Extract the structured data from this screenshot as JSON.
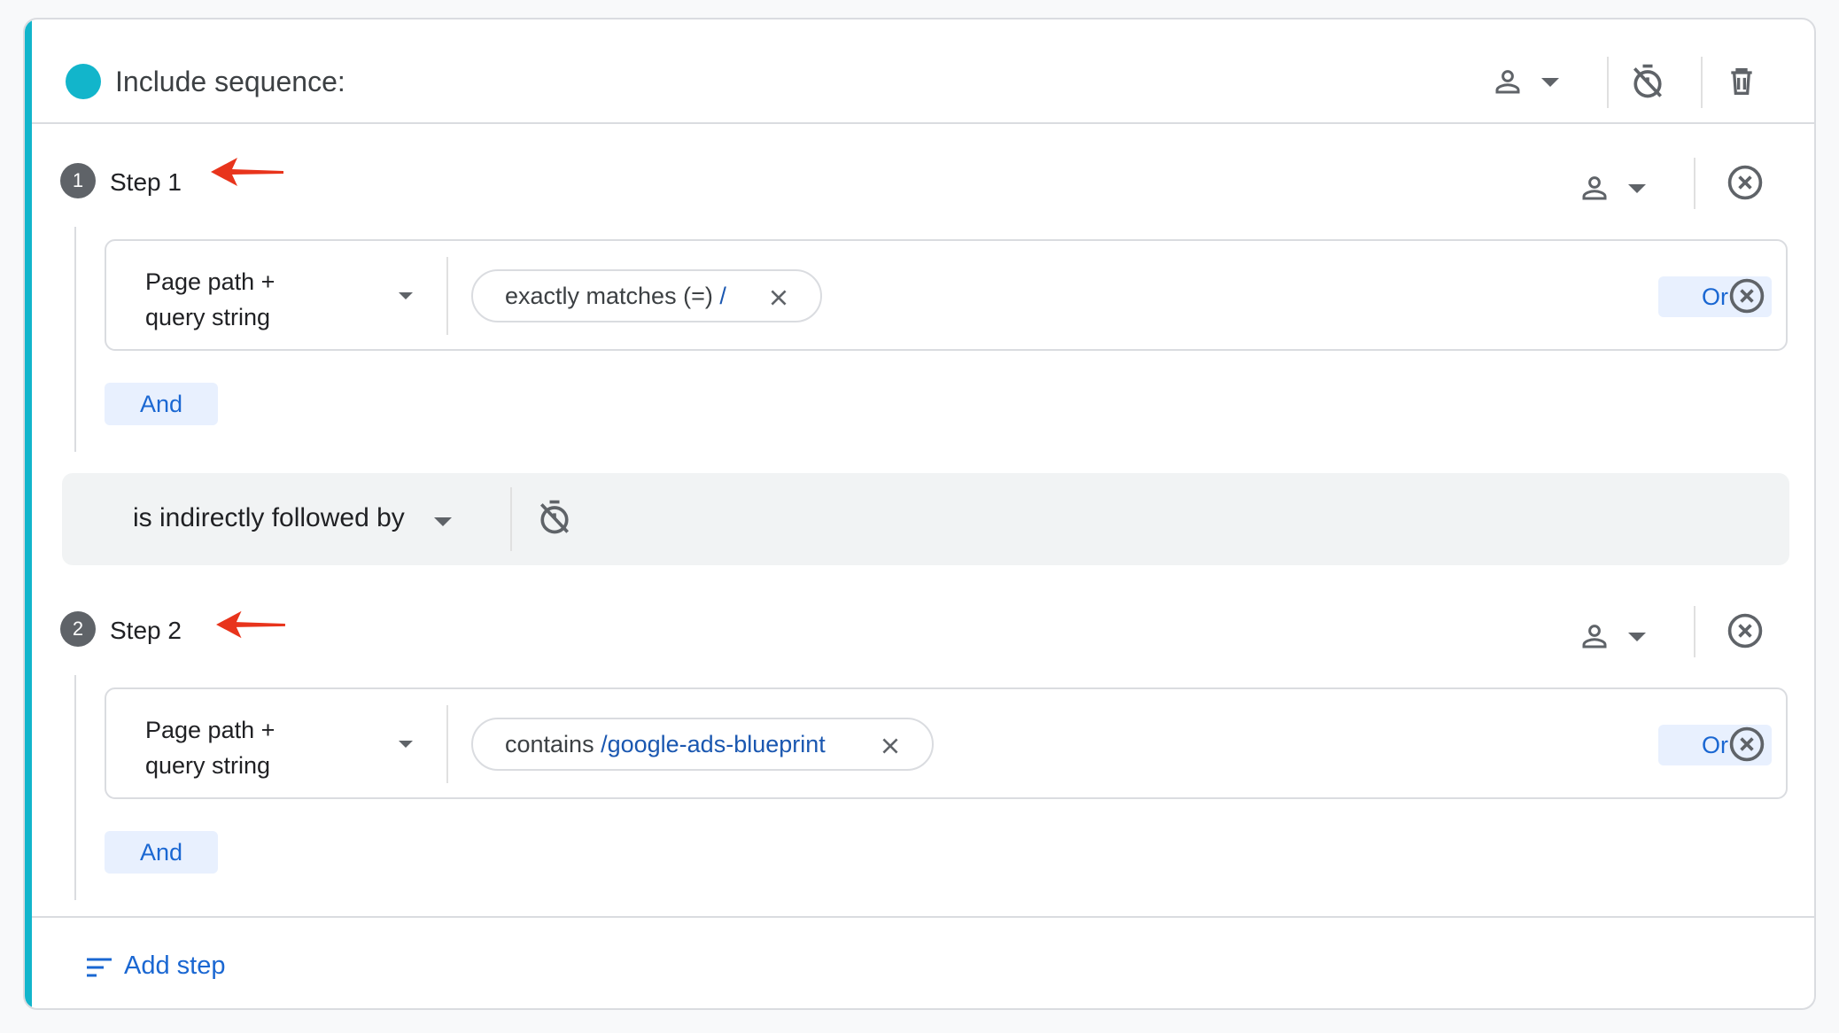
{
  "header": {
    "title": "Include sequence:"
  },
  "steps": [
    {
      "number": "1",
      "label": "Step 1",
      "dimension": "Page path + query string",
      "condition_operator": "exactly matches (=)",
      "condition_value": "/",
      "or_label": "Or",
      "and_label": "And"
    },
    {
      "number": "2",
      "label": "Step 2",
      "dimension": "Page path + query string",
      "condition_operator": "contains",
      "condition_value": "/google-ads-blueprint",
      "or_label": "Or",
      "and_label": "And"
    }
  ],
  "follow": {
    "label": "is indirectly followed by"
  },
  "footer": {
    "add_step_label": "Add step"
  },
  "icons": {
    "scope": "person-icon",
    "timer_off": "timer-off-icon",
    "delete": "trash-icon",
    "remove": "close-circle-icon",
    "clear": "close-icon",
    "annotation": "red-arrow-icon",
    "add_step": "sort-lines-icon"
  },
  "colors": {
    "accent": "#12b5cb",
    "link": "#1a67d2",
    "annotation_arrow": "#e8341c"
  }
}
